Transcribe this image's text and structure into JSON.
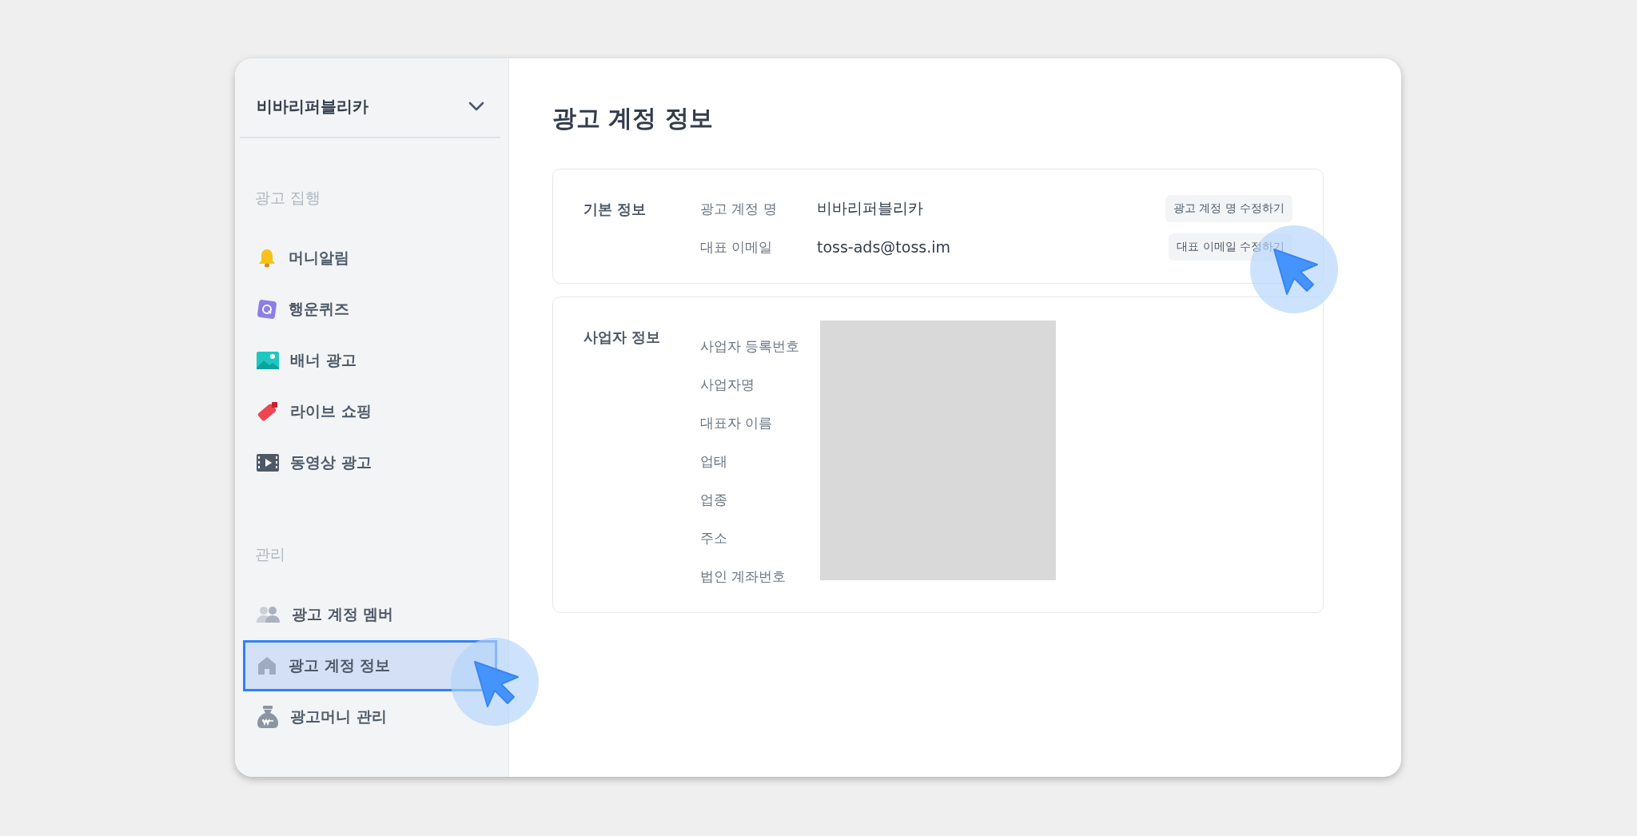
{
  "sidebar": {
    "account": "비바리퍼블리카",
    "sections": [
      {
        "title": "광고 집행",
        "items": [
          {
            "label": "머니알림",
            "selected": false
          },
          {
            "label": "행운퀴즈",
            "selected": false
          },
          {
            "label": "배너 광고",
            "selected": false
          },
          {
            "label": "라이브 쇼핑",
            "selected": false
          },
          {
            "label": "동영상 광고",
            "selected": false
          }
        ]
      },
      {
        "title": "관리",
        "items": [
          {
            "label": "광고 계정 멤버",
            "selected": false
          },
          {
            "label": "광고 계정 정보",
            "selected": true
          },
          {
            "label": "광고머니 관리",
            "selected": false
          }
        ]
      }
    ]
  },
  "main": {
    "title": "광고 계정 정보",
    "cards": [
      {
        "title": "기본 정보",
        "redacted": false,
        "fields": [
          {
            "label": "광고 계정 명",
            "value": "비바리퍼블리카",
            "action": "광고 계정 명 수정하기"
          },
          {
            "label": "대표 이메일",
            "value": "toss-ads@toss.im",
            "action": "대표 이메일 수정하기"
          }
        ]
      },
      {
        "title": "사업자 정보",
        "redacted": true,
        "fields": [
          {
            "label": "사업자 등록번호"
          },
          {
            "label": "사업자명"
          },
          {
            "label": "대표자 이름"
          },
          {
            "label": "업태"
          },
          {
            "label": "업종"
          },
          {
            "label": "주소"
          },
          {
            "label": "법인 계좌번호"
          }
        ]
      }
    ]
  }
}
